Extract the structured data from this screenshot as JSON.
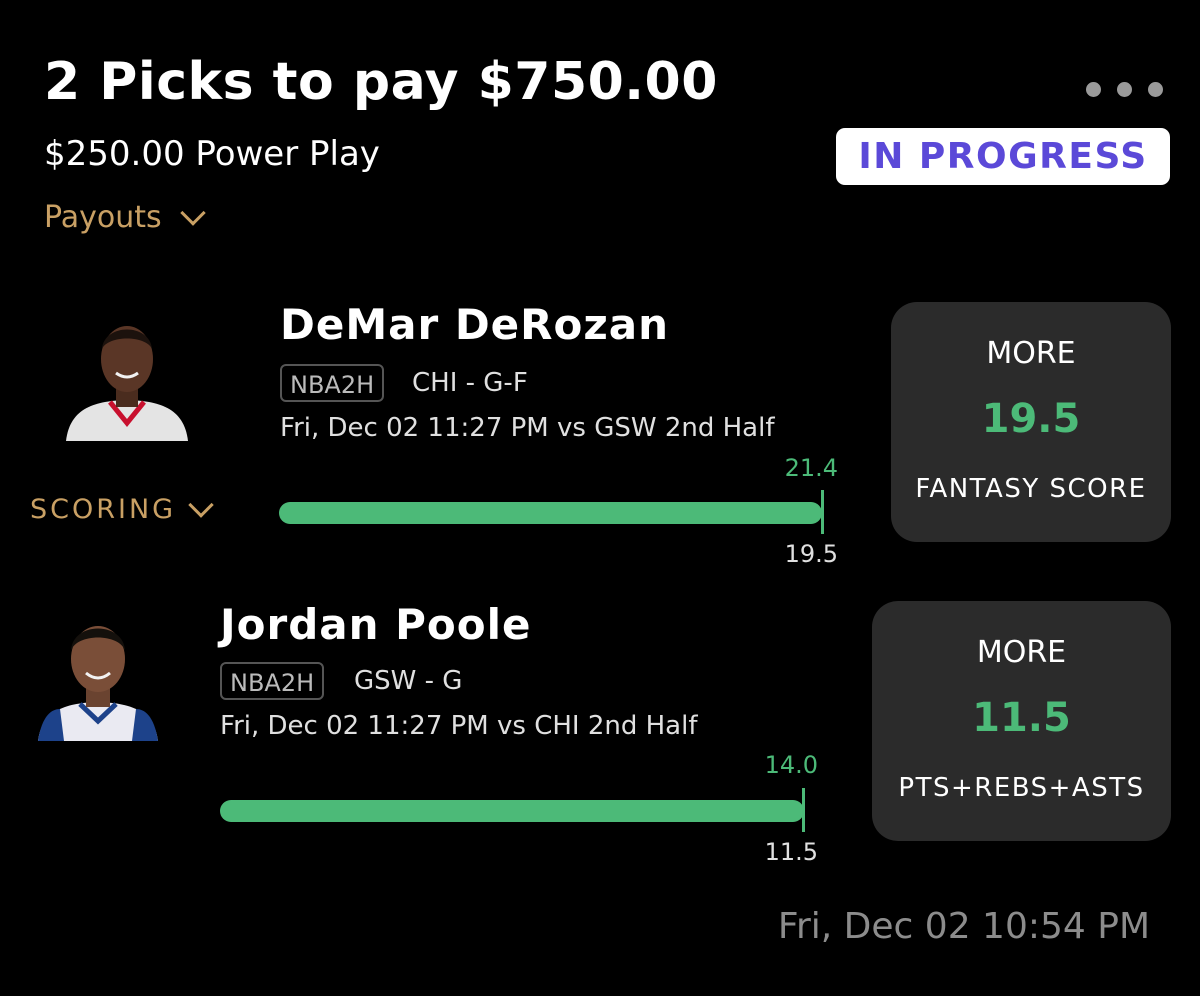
{
  "header": {
    "title": "2 Picks to pay $750.00",
    "subtitle": "$250.00 Power Play",
    "payouts_label": "Payouts",
    "status": "IN PROGRESS"
  },
  "scoring_label": "SCORING",
  "picks": [
    {
      "player": "DeMar DeRozan",
      "league": "NBA2H",
      "team_pos": "CHI - G-F",
      "game": "Fri, Dec 02 11:27 PM  vs GSW 2nd Half",
      "current": "21.4",
      "line": "19.5",
      "progress": 1.0,
      "direction": "MORE",
      "stat": "FANTASY SCORE",
      "jersey": "#e4e4e4",
      "trim": "#c8102e"
    },
    {
      "player": "Jordan Poole",
      "league": "NBA2H",
      "team_pos": "GSW - G",
      "game": "Fri, Dec 02 11:27 PM  vs CHI 2nd Half",
      "current": "14.0",
      "line": "11.5",
      "progress": 1.0,
      "direction": "MORE",
      "stat": "PTS+REBS+ASTS",
      "jersey": "#eaeaf2",
      "trim": "#1d428a"
    }
  ],
  "timestamp": "Fri, Dec 02 10:54 PM",
  "colors": {
    "accent_green": "#4cba78",
    "gold": "#c9a064",
    "status_purple": "#5b49d8",
    "card_bg": "#2b2b2b"
  }
}
